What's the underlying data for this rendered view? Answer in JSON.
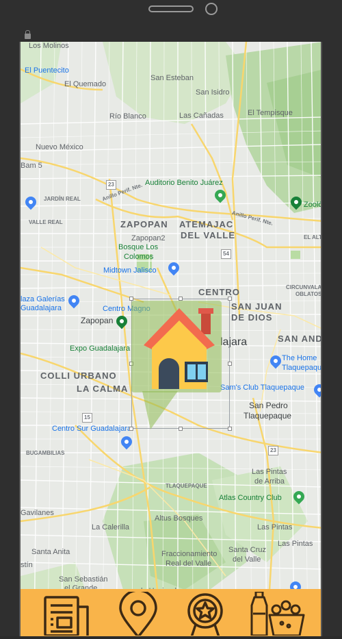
{
  "map": {
    "labels": {
      "los_molinos": "Los Molinos",
      "el_puentecito": "El Puentecito",
      "el_quemado": "El Quemado",
      "san_esteban": "San Esteban",
      "san_isidro": "San Isidro",
      "rio_blanco": "Río Blanco",
      "las_canadas": "Las Cañadas",
      "el_tempisque": "El Tempisque",
      "nuevo_mexico": "Nuevo México",
      "bam5": "Bam 5",
      "auditorio": "Auditorio Benito Juárez",
      "jardin_real": "JARDÍN REAL",
      "zoo": "Zoológ",
      "valle_real": "VALLE REAL",
      "zapopan_big": "ZAPOPAN",
      "atemajac": "ATEMAJAC",
      "del_valle": "DEL VALLE",
      "zapopan2": "Zapopan2",
      "bosque_los": "Bosque Los",
      "colomos": "Colomos",
      "el_alto": "EL ALTO",
      "midtown": "Midtown Jalisco",
      "centro": "CENTRO",
      "circunvalacion": "CIRCUNVALACIÓN",
      "oblatos": "OBLATOS",
      "plaza_galerias": "laza Galerías",
      "guadalajara_small": "Guadalajara",
      "centro_magno": "Centro Magno",
      "san_juan": "SAN JUAN",
      "de_dios": "DE DIOS",
      "zapopan_small": "Zapopan",
      "guadalajara_big": "lajara",
      "san_andres": "SAN AND",
      "expo": "Expo Guadalajara",
      "the_home": "The Home",
      "tlaquepaque": "Tlaquepaqu",
      "colli": "COLLI URBANO",
      "la_calma": "LA CALMA",
      "sams": "Sam's Club Tlaquepaque",
      "san_pedro": "San Pedro",
      "tlaquepaque2": "Tlaquepaque",
      "centro_sur": "Centro Sur Guadalajara",
      "bugambilias": "BUGAMBILIAS",
      "tlaquepaque_small": "TLAQUEPAQUE",
      "las_pintas_arriba": "Las Pintas",
      "de_arriba": "de Arriba",
      "atlas": "Atlas Country Club",
      "gavilanes": "Gavilanes",
      "la_calerilla": "La Calerilla",
      "altus": "Altus Bosques",
      "las_pintas": "Las Pintas",
      "santa_anita": "Santa Anita",
      "las_pintas2": "Las Pintas",
      "fracc": "Fraccionamiento",
      "real_valle": "Real del Valle",
      "santa_cruz": "Santa Cruz",
      "del_valle2": "del Valle",
      "agustin": "stín",
      "san_sebastian": "San Sebastián",
      "el_grande": "el Grande",
      "hacienda": "la Hacienda",
      "anillo1": "Anillo Perif. Nte.",
      "anillo2": "Anillo Perif. Nte.",
      "r23": "23",
      "r54": "54",
      "r15": "15",
      "r23b": "23"
    }
  },
  "bottom_nav": {
    "items": [
      {
        "name": "news",
        "icon": "newspaper-icon"
      },
      {
        "name": "location",
        "icon": "location-pin-icon"
      },
      {
        "name": "awards",
        "icon": "award-medal-icon"
      },
      {
        "name": "groceries",
        "icon": "grocery-bag-icon"
      }
    ]
  },
  "colors": {
    "nav_background": "#f9b44a",
    "icon_stroke": "#3d2a14",
    "roof": "#f26b4f",
    "house_wall": "#fdc94a",
    "marker_bubble": "#8fbc53"
  }
}
